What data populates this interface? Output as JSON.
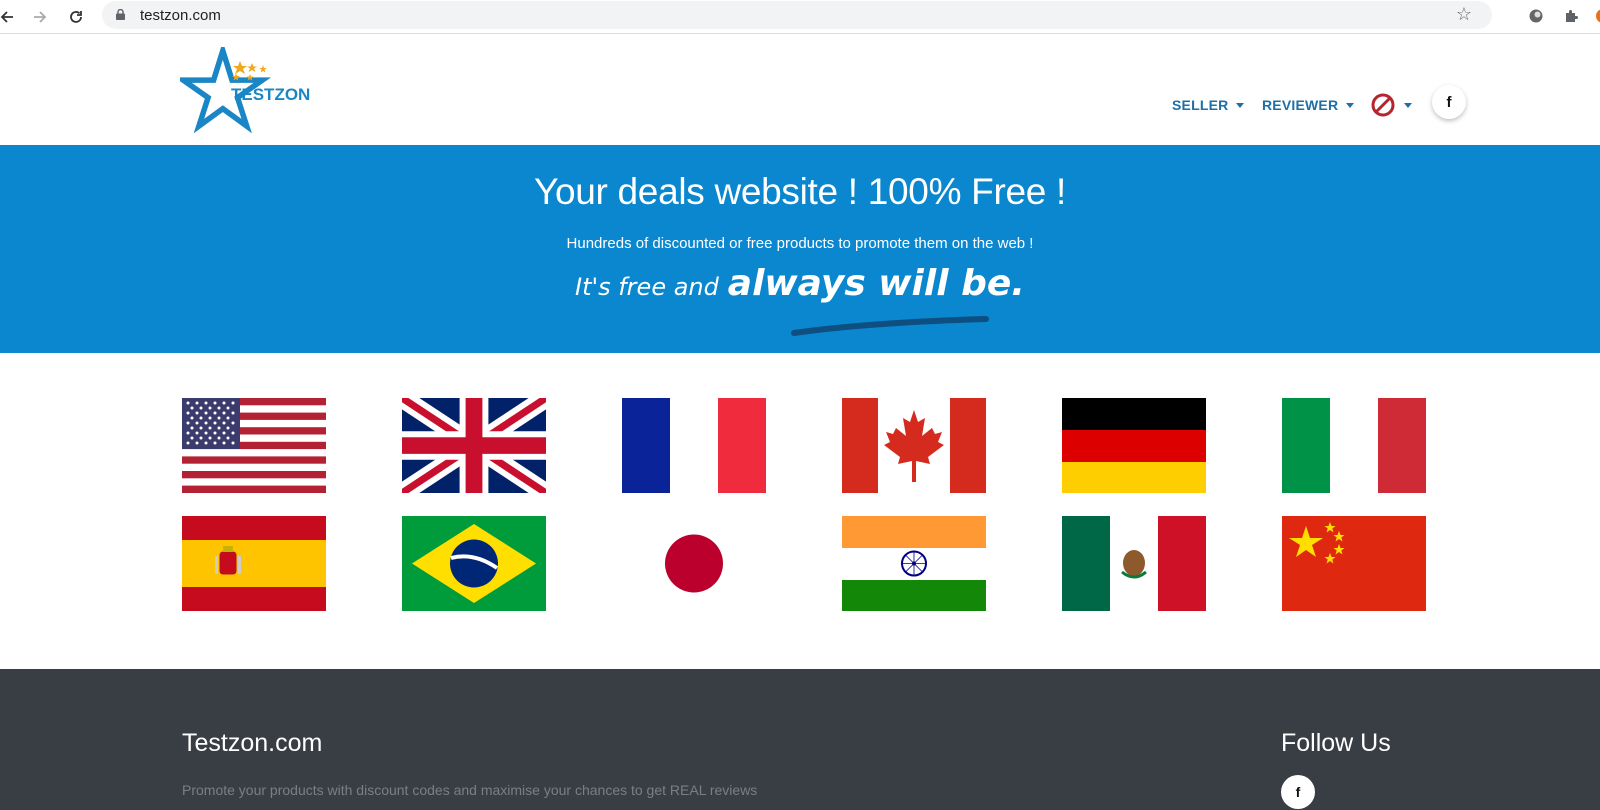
{
  "browser": {
    "url": "testzon.com",
    "back_icon": "arrow-left-icon",
    "forward_icon": "arrow-right-icon",
    "reload_icon": "reload-icon"
  },
  "header": {
    "logo_text": "TESTZON",
    "menu": [
      {
        "label": "SELLER"
      },
      {
        "label": "REVIEWER"
      }
    ],
    "language_icon": "no-entry-icon",
    "facebook_label": "f"
  },
  "hero": {
    "title": "Your deals website ! 100% Free !",
    "subtitle": "Hundreds of discounted or free products to promote them on the web !",
    "slogan_part1": "It's free and",
    "slogan_part2": "always will be.",
    "background": "#0a87cf"
  },
  "flags": [
    {
      "country": "United States"
    },
    {
      "country": "United Kingdom"
    },
    {
      "country": "France"
    },
    {
      "country": "Canada"
    },
    {
      "country": "Germany"
    },
    {
      "country": "Italy"
    },
    {
      "country": "Spain"
    },
    {
      "country": "Brazil"
    },
    {
      "country": "Japan"
    },
    {
      "country": "India"
    },
    {
      "country": "Mexico"
    },
    {
      "country": "China"
    }
  ],
  "footer": {
    "title": "Testzon.com",
    "description": "Promote your products with discount codes and maximise your chances to get REAL reviews",
    "follow_title": "Follow Us",
    "facebook_label": "f",
    "background": "#393d44"
  }
}
